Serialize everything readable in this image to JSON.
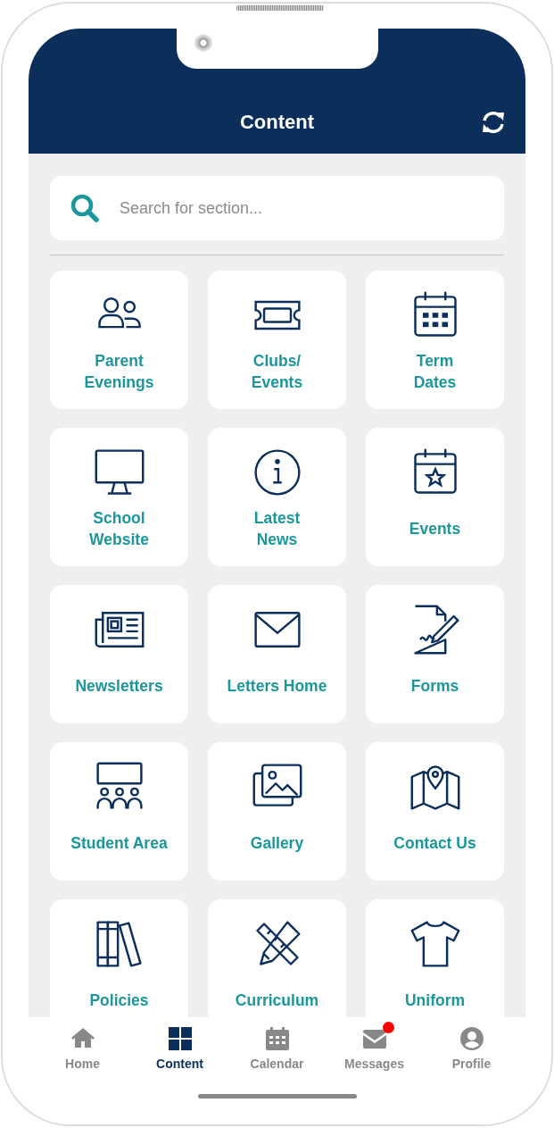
{
  "header": {
    "title": "Content"
  },
  "search": {
    "placeholder": "Search for section..."
  },
  "tiles": [
    {
      "label": "Parent\nEvenings"
    },
    {
      "label": "Clubs/\nEvents"
    },
    {
      "label": "Term\nDates"
    },
    {
      "label": "School\nWebsite"
    },
    {
      "label": "Latest\nNews"
    },
    {
      "label": "Events"
    },
    {
      "label": "Newsletters"
    },
    {
      "label": "Letters Home"
    },
    {
      "label": "Forms"
    },
    {
      "label": "Student Area"
    },
    {
      "label": "Gallery"
    },
    {
      "label": "Contact Us"
    },
    {
      "label": "Policies"
    },
    {
      "label": "Curriculum"
    },
    {
      "label": "Uniform"
    }
  ],
  "tab_bar": [
    {
      "label": "Home",
      "selected": false,
      "unread": false
    },
    {
      "label": "Content",
      "selected": true,
      "unread": false
    },
    {
      "label": "Calendar",
      "selected": false,
      "unread": false
    },
    {
      "label": "Messages",
      "selected": false,
      "unread": true
    },
    {
      "label": "Profile",
      "selected": false,
      "unread": false
    }
  ]
}
